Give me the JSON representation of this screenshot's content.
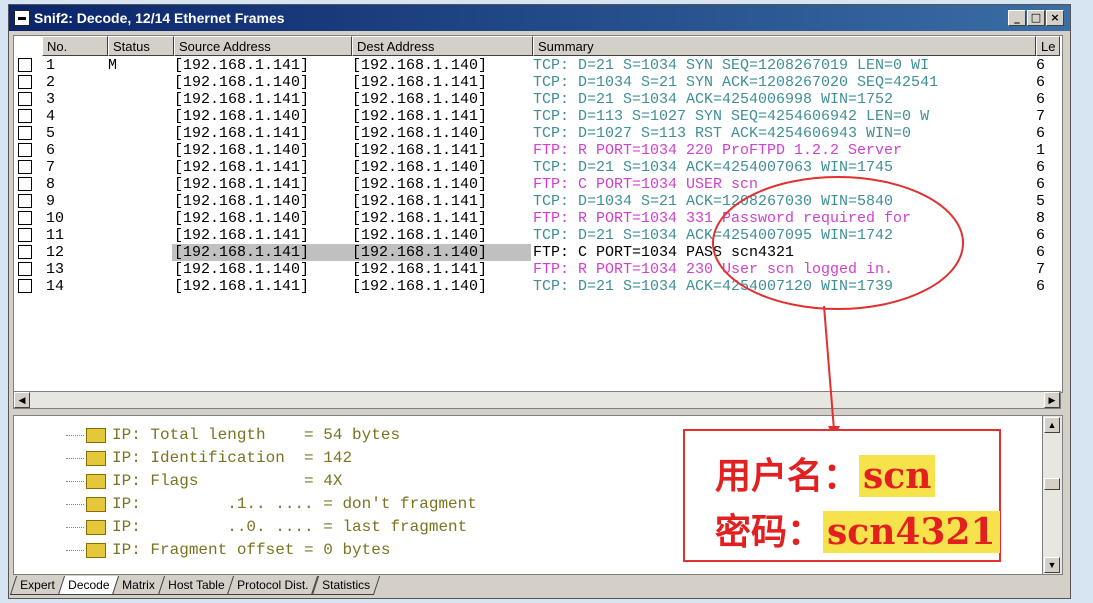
{
  "window": {
    "title": "Snif2: Decode, 12/14 Ethernet Frames",
    "controls": {
      "minimize": "_",
      "maximize": "□",
      "close": "×"
    }
  },
  "columns": [
    "No.",
    "Status",
    "Source Address",
    "Dest Address",
    "Summary",
    "Le"
  ],
  "rows": [
    {
      "no": "1",
      "status": "M",
      "src": "[192.168.1.141]",
      "dst": "[192.168.1.140]",
      "summary": "TCP: D=21 S=1034 SYN SEQ=1208267019 LEN=0 WI",
      "le": "6",
      "color": "#3f8f96"
    },
    {
      "no": "2",
      "status": "",
      "src": "[192.168.1.140]",
      "dst": "[192.168.1.141]",
      "summary": "TCP: D=1034 S=21 SYN ACK=1208267020 SEQ=42541",
      "le": "6",
      "color": "#3f8f96"
    },
    {
      "no": "3",
      "status": "",
      "src": "[192.168.1.141]",
      "dst": "[192.168.1.140]",
      "summary": "TCP: D=21 S=1034     ACK=4254006998 WIN=1752",
      "le": "6",
      "color": "#3f8f96"
    },
    {
      "no": "4",
      "status": "",
      "src": "[192.168.1.140]",
      "dst": "[192.168.1.141]",
      "summary": "TCP: D=113 S=1027 SYN SEQ=4254606942 LEN=0 W",
      "le": "7",
      "color": "#3f8f96"
    },
    {
      "no": "5",
      "status": "",
      "src": "[192.168.1.141]",
      "dst": "[192.168.1.140]",
      "summary": "TCP: D=1027 S=113 RST ACK=4254606943 WIN=0",
      "le": "6",
      "color": "#3f8f96"
    },
    {
      "no": "6",
      "status": "",
      "src": "[192.168.1.140]",
      "dst": "[192.168.1.141]",
      "summary": "FTP: R PORT=1034   220 ProFTPD 1.2.2 Server",
      "le": "1",
      "color": "#d040d0"
    },
    {
      "no": "7",
      "status": "",
      "src": "[192.168.1.141]",
      "dst": "[192.168.1.140]",
      "summary": "TCP: D=21 S=1034     ACK=4254007063 WIN=1745",
      "le": "6",
      "color": "#3f8f96"
    },
    {
      "no": "8",
      "status": "",
      "src": "[192.168.1.141]",
      "dst": "[192.168.1.140]",
      "summary": "FTP: C PORT=1034   USER scn",
      "le": "6",
      "color": "#d040d0"
    },
    {
      "no": "9",
      "status": "",
      "src": "[192.168.1.140]",
      "dst": "[192.168.1.141]",
      "summary": "TCP: D=1034 S=21     ACK=1208267030 WIN=5840",
      "le": "5",
      "color": "#3f8f96"
    },
    {
      "no": "10",
      "status": "",
      "src": "[192.168.1.140]",
      "dst": "[192.168.1.141]",
      "summary": "FTP: R PORT=1034   331 Password required for",
      "le": "8",
      "color": "#d040d0"
    },
    {
      "no": "11",
      "status": "",
      "src": "[192.168.1.141]",
      "dst": "[192.168.1.140]",
      "summary": "TCP: D=21 S=1034     ACK=4254007095 WIN=1742",
      "le": "6",
      "color": "#3f8f96"
    },
    {
      "no": "12",
      "status": "",
      "src": "[192.168.1.141]",
      "dst": "[192.168.1.140]",
      "summary": "FTP: C PORT=1034   PASS scn4321",
      "le": "6",
      "color": "#000000"
    },
    {
      "no": "13",
      "status": "",
      "src": "[192.168.1.140]",
      "dst": "[192.168.1.141]",
      "summary": "FTP: R PORT=1034   230 User scn logged in.",
      "le": "7",
      "color": "#d040d0"
    },
    {
      "no": "14",
      "status": "",
      "src": "[192.168.1.141]",
      "dst": "[192.168.1.140]",
      "summary": "TCP: D=21 S=1034     ACK=4254007120 WIN=1739",
      "le": "6",
      "color": "#3f8f96"
    }
  ],
  "selected_row": "12",
  "detail_lines": [
    "IP: Total length    = 54 bytes",
    "IP: Identification  = 142",
    "IP: Flags           = 4X",
    "IP:         .1.. .... = don't fragment",
    "IP:         ..0. .... = last fragment",
    "IP: Fragment offset = 0 bytes"
  ],
  "annotation": {
    "user_label": "用户名：",
    "user_value": "scn",
    "pass_label": "密码：",
    "pass_value": "scn4321"
  },
  "tabs": [
    "Expert",
    "Decode",
    "Matrix",
    "Host Table",
    "Protocol Dist.",
    "Statistics"
  ],
  "active_tab": "Decode",
  "colors": {
    "tcp": "#3f8f96",
    "ftp": "#d040d0",
    "annotation": "#e32020",
    "highlight": "#f6e24a"
  }
}
